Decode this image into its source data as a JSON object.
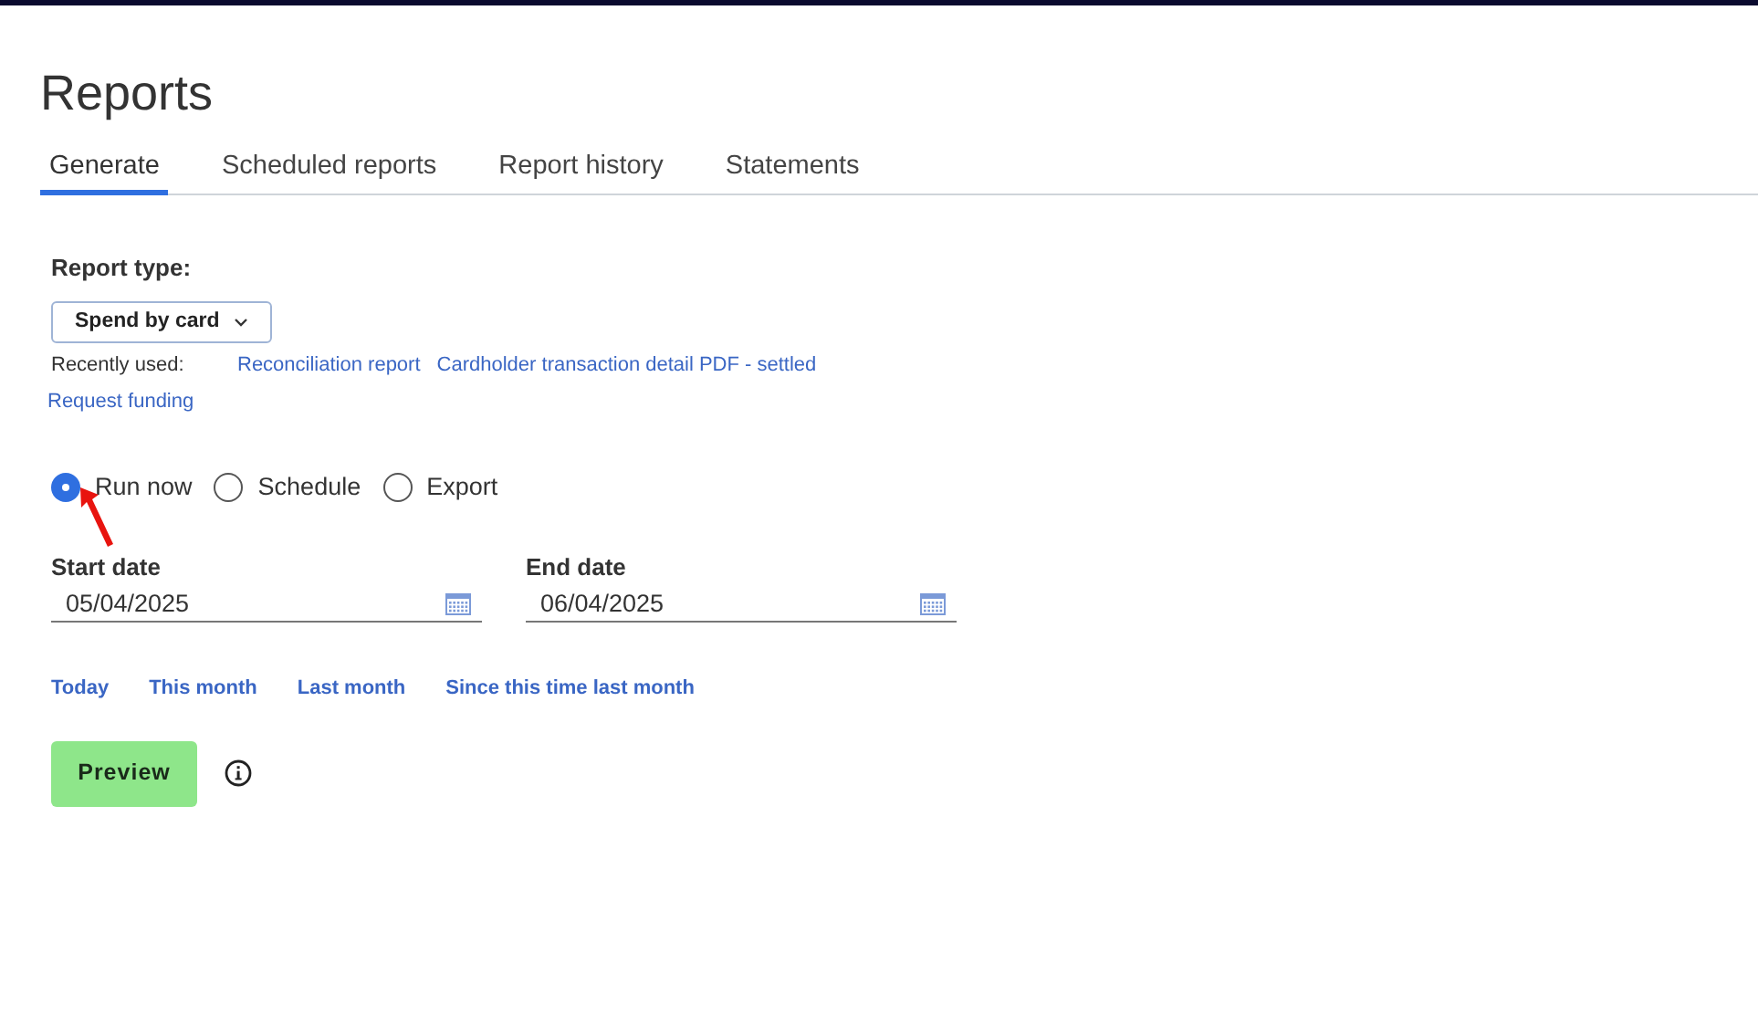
{
  "page_title": "Reports",
  "tabs": [
    {
      "label": "Generate",
      "selected": true
    },
    {
      "label": "Scheduled reports",
      "selected": false
    },
    {
      "label": "Report history",
      "selected": false
    },
    {
      "label": "Statements",
      "selected": false
    }
  ],
  "report_type": {
    "label": "Report type:",
    "value": "Spend by card"
  },
  "recently_used": {
    "label": "Recently used:",
    "links": [
      "Reconciliation report",
      "Cardholder transaction detail PDF - settled"
    ]
  },
  "request_funding": "Request funding",
  "run_options": [
    {
      "label": "Run now",
      "selected": true
    },
    {
      "label": "Schedule",
      "selected": false
    },
    {
      "label": "Export",
      "selected": false
    }
  ],
  "dates": [
    {
      "label": "Start date",
      "value": "05/04/2025"
    },
    {
      "label": "End date",
      "value": "06/04/2025"
    }
  ],
  "quick_ranges": [
    "Today",
    "This month",
    "Last month",
    "Since this time last month"
  ],
  "preview_button": "Preview"
}
